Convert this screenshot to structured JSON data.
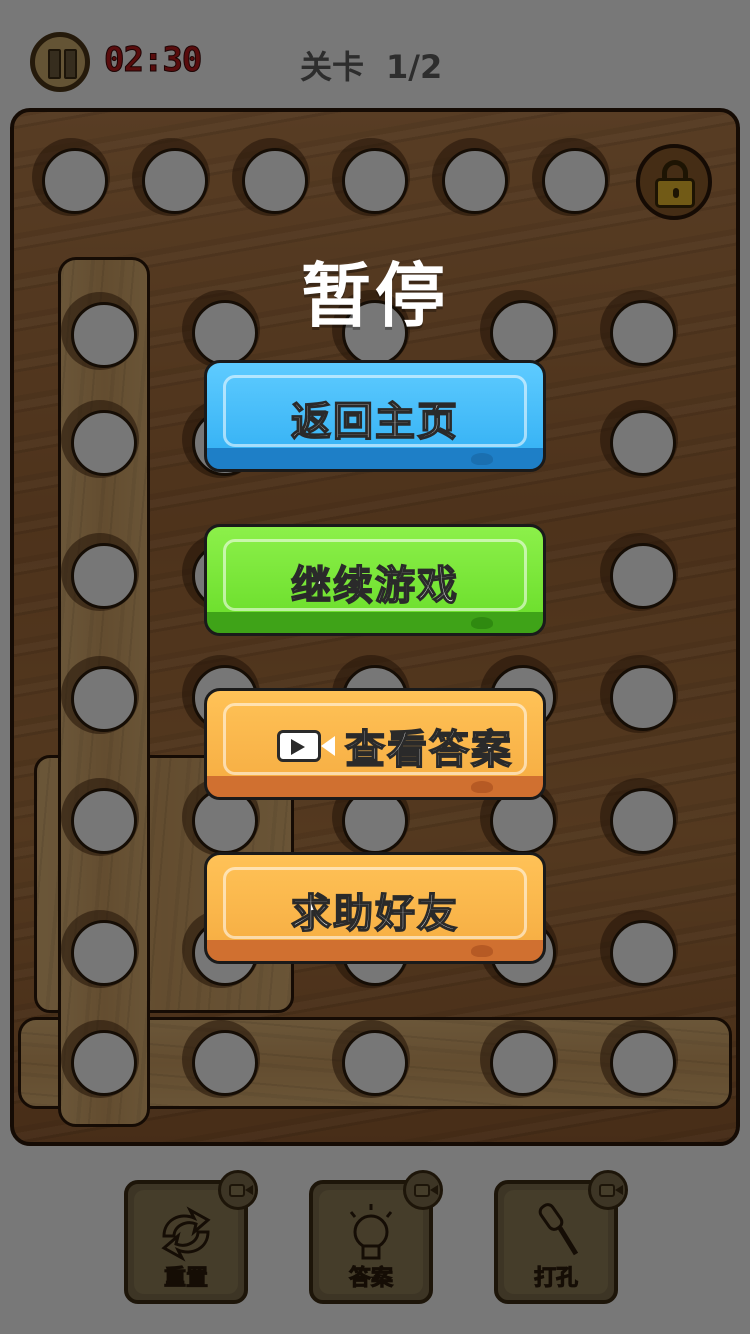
{
  "header": {
    "timer": "02:30",
    "level_label": "关卡",
    "level_progress": "1/2"
  },
  "pause_menu": {
    "title": "暂停",
    "buttons": [
      {
        "label": "返回主页",
        "color": "#39b4f5"
      },
      {
        "label": "继续游戏",
        "color": "#6fe02f"
      },
      {
        "label": "查看答案",
        "color": "#f7b045",
        "icon": "video-icon"
      },
      {
        "label": "求助好友",
        "color": "#f7b045"
      }
    ]
  },
  "toolbar": {
    "items": [
      {
        "label": "重置",
        "icon": "reset-arrows-icon"
      },
      {
        "label": "答案",
        "icon": "lightbulb-icon"
      },
      {
        "label": "打孔",
        "icon": "screwdriver-icon"
      }
    ]
  }
}
